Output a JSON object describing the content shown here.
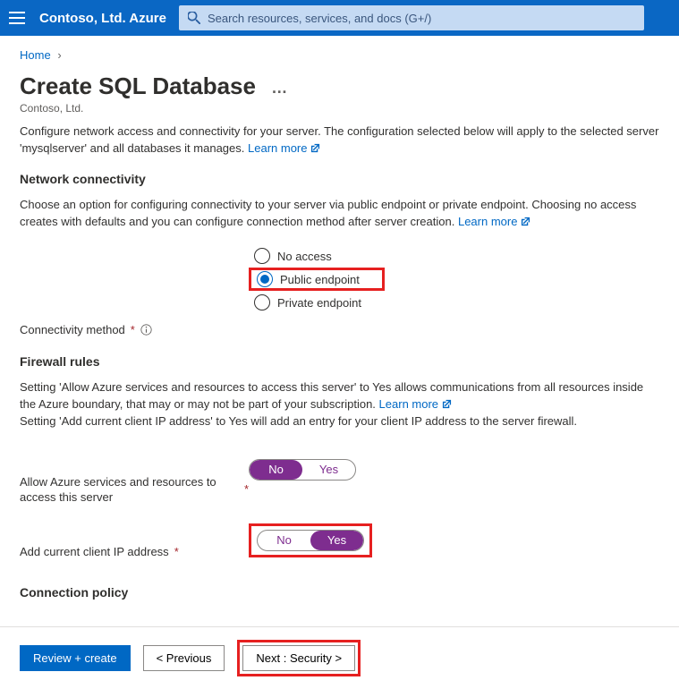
{
  "topbar": {
    "tenant": "Contoso, Ltd. Azure",
    "search_placeholder": "Search resources, services, and docs (G+/)"
  },
  "breadcrumb": {
    "home": "Home"
  },
  "page": {
    "title": "Create SQL Database",
    "subtitle": "Contoso, Ltd.",
    "intro": "Configure network access and connectivity for your server. The configuration selected below will apply to the selected server 'mysqlserver' and all databases it manages.",
    "learn_more": "Learn more"
  },
  "network": {
    "section_title": "Network connectivity",
    "desc": "Choose an option for configuring connectivity to your server via public endpoint or private endpoint. Choosing no access creates with defaults and you can configure connection method after server creation.",
    "learn_more": "Learn more",
    "label": "Connectivity method",
    "options": {
      "no_access": "No access",
      "public": "Public endpoint",
      "private": "Private endpoint"
    }
  },
  "firewall": {
    "section_title": "Firewall rules",
    "desc1": "Setting 'Allow Azure services and resources to access this server' to Yes allows communications from all resources inside the Azure boundary, that may or may not be part of your subscription.",
    "learn_more": "Learn more",
    "desc2": "Setting 'Add current client IP address' to Yes will add an entry for your client IP address to the server firewall.",
    "allow_azure_label": "Allow Azure services and resources to access this server",
    "add_client_ip_label": "Add current client IP address",
    "toggle_no": "No",
    "toggle_yes": "Yes"
  },
  "connection_policy": {
    "section_title": "Connection policy"
  },
  "footer": {
    "review": "Review + create",
    "previous": "< Previous",
    "next": "Next : Security >"
  }
}
